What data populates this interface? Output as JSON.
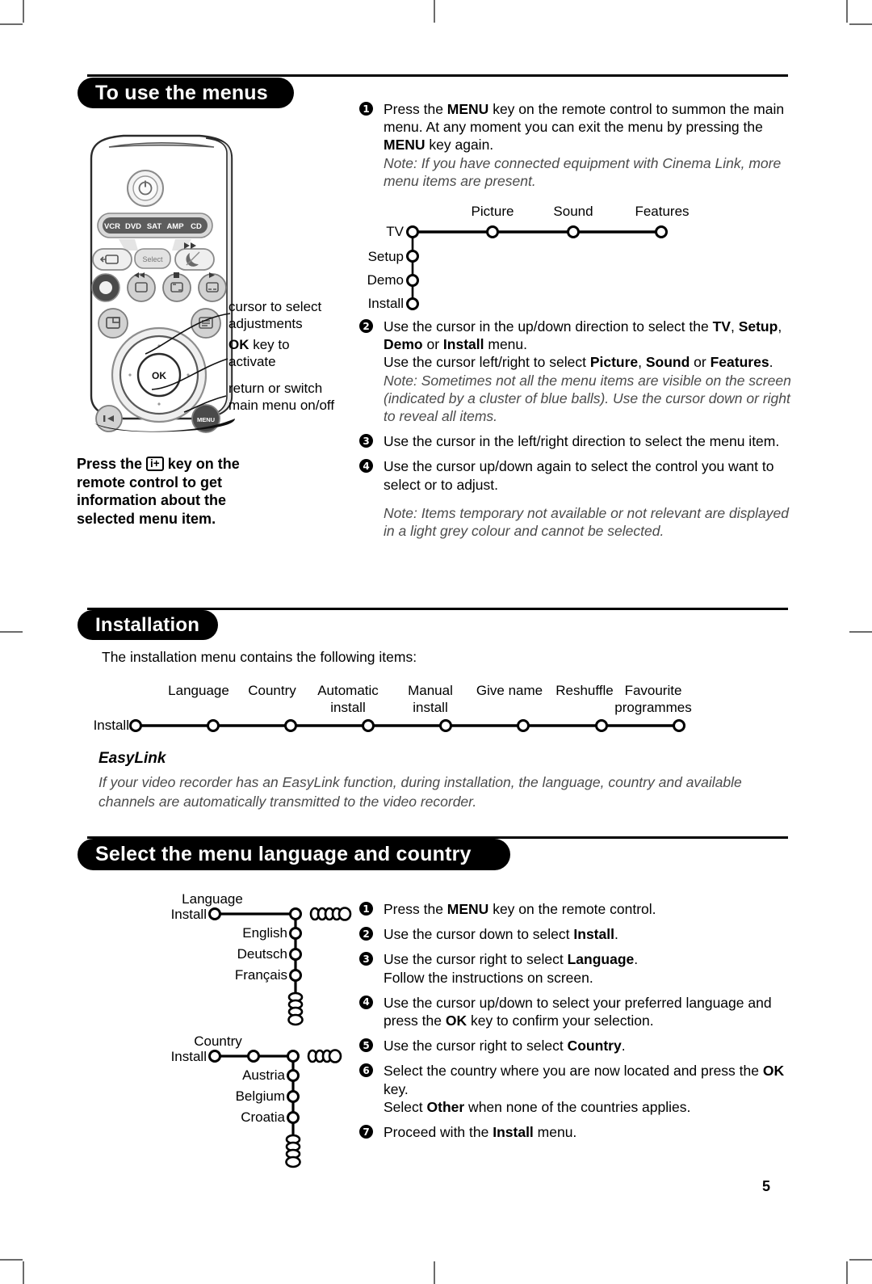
{
  "page": {
    "number": "5"
  },
  "sections": [
    {
      "id": "to-use-the-menus",
      "title": "To use the menus"
    },
    {
      "id": "installation",
      "title": "Installation"
    },
    {
      "id": "select-language-country",
      "title": "Select the menu language and country"
    }
  ],
  "remote": {
    "power_icon": "power-icon",
    "mode_keys": [
      "VCR",
      "DVD",
      "SAT",
      "AMP",
      "CD"
    ],
    "select_key": "Select",
    "ok_key": "OK",
    "menu_key": "MENU",
    "callouts": [
      {
        "line1": "cursor to select",
        "line2": "adjustments"
      },
      {
        "bold": "OK",
        "line1": " key to",
        "line2": "activate"
      },
      {
        "line1": "return or switch",
        "line2": "main menu on/off"
      }
    ],
    "info_note": {
      "pre": "Press the ",
      "key": "i+",
      "post": " key on the remote control to get information about the selected menu item."
    }
  },
  "menu_steps": [
    {
      "num": "1",
      "parts": [
        {
          "t": "Press the ",
          "b": false
        },
        {
          "t": "MENU",
          "b": true
        },
        {
          "t": " key on the remote control to summon the main menu. At any moment you can exit the menu by pressing the ",
          "b": false
        },
        {
          "t": "MENU",
          "b": true
        },
        {
          "t": " key again.",
          "b": false
        }
      ],
      "note": "Note: If you have connected equipment with Cinema Link, more menu items are present."
    },
    {
      "num": "2",
      "parts": [
        {
          "t": "Use the cursor in the up/down direction to select the ",
          "b": false
        },
        {
          "t": "TV",
          "b": true
        },
        {
          "t": ", ",
          "b": false
        },
        {
          "t": "Setup",
          "b": true
        },
        {
          "t": ", ",
          "b": false
        },
        {
          "t": "Demo",
          "b": true
        },
        {
          "t": " or ",
          "b": false
        },
        {
          "t": "Install",
          "b": true
        },
        {
          "t": " menu.",
          "b": false
        },
        {
          "t": "\nUse the cursor left/right to select ",
          "b": false
        },
        {
          "t": "Picture",
          "b": true
        },
        {
          "t": ", ",
          "b": false
        },
        {
          "t": "Sound",
          "b": true
        },
        {
          "t": " or ",
          "b": false
        },
        {
          "t": "Features",
          "b": true
        },
        {
          "t": ".",
          "b": false
        }
      ],
      "note": "Note: Sometimes not all the menu items are visible on the screen (indicated by a cluster of blue balls). Use the cursor down or right to reveal all items."
    },
    {
      "num": "3",
      "parts": [
        {
          "t": "Use the cursor in the left/right direction to select the menu item.",
          "b": false
        }
      ],
      "note": ""
    },
    {
      "num": "4",
      "parts": [
        {
          "t": "Use the cursor up/down again to select the control you want to select or to adjust.",
          "b": false
        }
      ],
      "note": "Note: Items temporary not available or not relevant are displayed in a light grey colour and cannot be selected."
    }
  ],
  "main_menu_diagram": {
    "root_labels": [
      "TV",
      "Setup",
      "Demo",
      "Install"
    ],
    "branch_labels": [
      "Picture",
      "Sound",
      "Features"
    ]
  },
  "installation": {
    "intro": "The installation menu contains the following items:",
    "root_label": "Install",
    "items": [
      {
        "l1": "Language",
        "l2": ""
      },
      {
        "l1": "Country",
        "l2": ""
      },
      {
        "l1": "Automatic",
        "l2": "install"
      },
      {
        "l1": "Manual",
        "l2": "install"
      },
      {
        "l1": "Give name",
        "l2": ""
      },
      {
        "l1": "Reshuffle",
        "l2": ""
      },
      {
        "l1": "Favourite",
        "l2": "programmes"
      }
    ],
    "easylink_heading": "EasyLink",
    "easylink_text": "If your video recorder has an EasyLink function, during installation, the language, country and available channels are automatically transmitted to the video recorder."
  },
  "language_diagram": {
    "root_label": "Install",
    "branch_label": "Language",
    "options": [
      "English",
      "Deutsch",
      "Français"
    ]
  },
  "country_diagram": {
    "root_label": "Install",
    "branch_label": "Country",
    "options": [
      "Austria",
      "Belgium",
      "Croatia"
    ]
  },
  "language_steps": [
    {
      "num": "1",
      "parts": [
        {
          "t": "Press the ",
          "b": false
        },
        {
          "t": "MENU",
          "b": true
        },
        {
          "t": " key on the remote control.",
          "b": false
        }
      ]
    },
    {
      "num": "2",
      "parts": [
        {
          "t": "Use the cursor down to select ",
          "b": false
        },
        {
          "t": "Install",
          "b": true
        },
        {
          "t": ".",
          "b": false
        }
      ]
    },
    {
      "num": "3",
      "parts": [
        {
          "t": "Use the cursor right to select ",
          "b": false
        },
        {
          "t": "Language",
          "b": true
        },
        {
          "t": ".\nFollow the instructions on screen.",
          "b": false
        }
      ]
    },
    {
      "num": "4",
      "parts": [
        {
          "t": "Use the cursor up/down to select your preferred language and press the ",
          "b": false
        },
        {
          "t": "OK",
          "b": true
        },
        {
          "t": " key to confirm your selection.",
          "b": false
        }
      ]
    },
    {
      "num": "5",
      "parts": [
        {
          "t": "Use the cursor right to select ",
          "b": false
        },
        {
          "t": "Country",
          "b": true
        },
        {
          "t": ".",
          "b": false
        }
      ]
    },
    {
      "num": "6",
      "parts": [
        {
          "t": "Select the country where you are now located and press the ",
          "b": false
        },
        {
          "t": "OK",
          "b": true
        },
        {
          "t": " key.\nSelect ",
          "b": false
        },
        {
          "t": "Other",
          "b": true
        },
        {
          "t": " when none of the countries applies.",
          "b": false
        }
      ]
    },
    {
      "num": "7",
      "parts": [
        {
          "t": "Proceed with the ",
          "b": false
        },
        {
          "t": "Install",
          "b": true
        },
        {
          "t": " menu.",
          "b": false
        }
      ]
    }
  ],
  "colors": {
    "ink": "#000000",
    "note_grey": "#4b4b4b",
    "crop": "#6b6b6b"
  }
}
